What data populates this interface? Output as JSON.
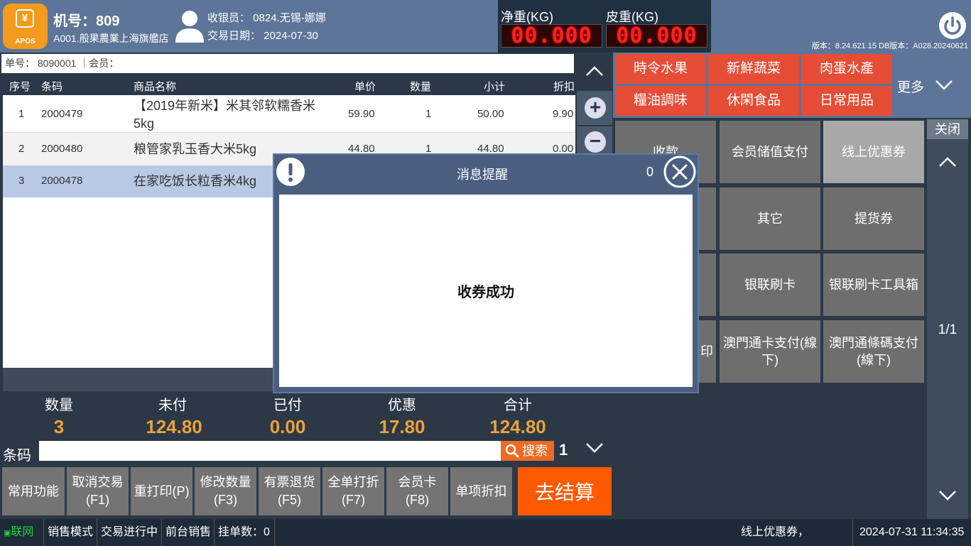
{
  "header": {
    "logo_text": "APOS",
    "machine_label": "机号：809",
    "store": "A001.般果農業上海旗艦店",
    "cashier": "收银员： 0824.无锡-娜娜",
    "trade_date": "交易日期： 2024-07-30",
    "net_weight_label": "净重(KG)",
    "net_weight_value": "00.000",
    "tare_weight_label": "皮重(KG)",
    "tare_weight_value": "00.000",
    "version": "版本：8.24.621.15 DB版本：A028.20240621"
  },
  "order": {
    "order_no": "单号：  8090001   ｜会员："
  },
  "table": {
    "headers": [
      "序号",
      "条码",
      "商品名称",
      "单价",
      "数量",
      "小计",
      "折扣"
    ],
    "rows": [
      {
        "seq": "1",
        "code": "2000479",
        "name": "【2019年新米】米其邻软糯香米5kg",
        "price": "59.90",
        "qty": "1",
        "subtotal": "50.00",
        "discount": "9.90"
      },
      {
        "seq": "2",
        "code": "2000480",
        "name": "粮管家乳玉香大米5kg",
        "price": "44.80",
        "qty": "1",
        "subtotal": "44.80",
        "discount": "0.00"
      },
      {
        "seq": "3",
        "code": "2000478",
        "name": "在家吃饭长粒香米4kg",
        "price": "",
        "qty": "",
        "subtotal": "",
        "discount": ""
      }
    ]
  },
  "totals": {
    "qty_label": "数量",
    "qty": "3",
    "unpaid_label": "未付",
    "unpaid": "124.80",
    "paid_label": "已付",
    "paid": "0.00",
    "discount_label": "优惠",
    "discount": "17.80",
    "total_label": "合计",
    "total": "124.80"
  },
  "barcode": {
    "label": "条码",
    "search": "搜索",
    "page": "1"
  },
  "functions": {
    "common": "常用功能",
    "cancel": "取消交易\n(F1)",
    "reprint": "重打印(P)",
    "modify_qty": "修改数量\n(F3)",
    "refund": "有票退货\n(F5)",
    "whole_discount": "全单打折\n(F7)",
    "member_card": "会员卡\n(F8)",
    "item_discount": "单项折扣",
    "checkout": "去结算"
  },
  "status": {
    "network": "联网",
    "mode": "销售模式",
    "trade": "交易进行中",
    "front": "前台销售",
    "hold": "挂单数：0",
    "message": "线上优惠券，",
    "datetime": "2024-07-31 11:34:35"
  },
  "categories": [
    "時令水果",
    "新鮮蔬菜",
    "肉蛋水產",
    "糧油調味",
    "休閑食品",
    "日常用品"
  ],
  "more_label": "更多",
  "payments": {
    "collect": "收款",
    "member_stored": "会员储值支付",
    "online_coupon": "线上优惠券",
    "other": "其它",
    "pickup": "提货券",
    "unionpay": "银联刷卡",
    "unionpay_tools": "银联刷卡工具箱",
    "print_fragment": "印",
    "macau_card": "澳門通卡支付(線下)",
    "macau_barcode": "澳門通條碼支付(線下)"
  },
  "close_label": "关闭",
  "pagination": "1/1",
  "dialog": {
    "title": "消息提醒",
    "count": "0",
    "message": "收券成功"
  },
  "colors": {
    "accent": "#ff5a00",
    "category": "#e64d36",
    "header": "#5d7598",
    "value": "#e9a23a"
  }
}
